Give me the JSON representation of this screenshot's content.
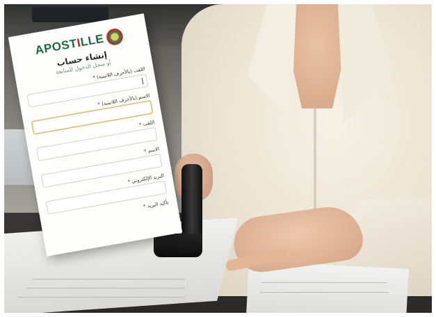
{
  "form": {
    "logo_main": "APOST",
    "logo_accent": "I",
    "logo_tail": "LLE",
    "title": "إنشاء حساب",
    "subtitle": "أو سجل الدخول للمتابعة",
    "fields": [
      {
        "label": "اللقب (بالأحرف اللاتينية) *",
        "focused": false,
        "caret": true
      },
      {
        "label": "الاسم (بالأحرف اللاتينية) *",
        "focused": true,
        "caret": false
      },
      {
        "label": "اللقب *",
        "focused": false,
        "caret": false
      },
      {
        "label": "الاسم *",
        "focused": false,
        "caret": false
      },
      {
        "label": "البريد الإلكتروني *",
        "focused": false,
        "caret": false
      },
      {
        "label": "تأكيد البريد *",
        "focused": false,
        "caret": false
      }
    ]
  },
  "colors": {
    "logo_green": "#1d6b3a",
    "logo_red": "#c5202d",
    "focus_border": "#c9b06a"
  },
  "icons": {
    "seal": "apostille-seal-icon"
  }
}
